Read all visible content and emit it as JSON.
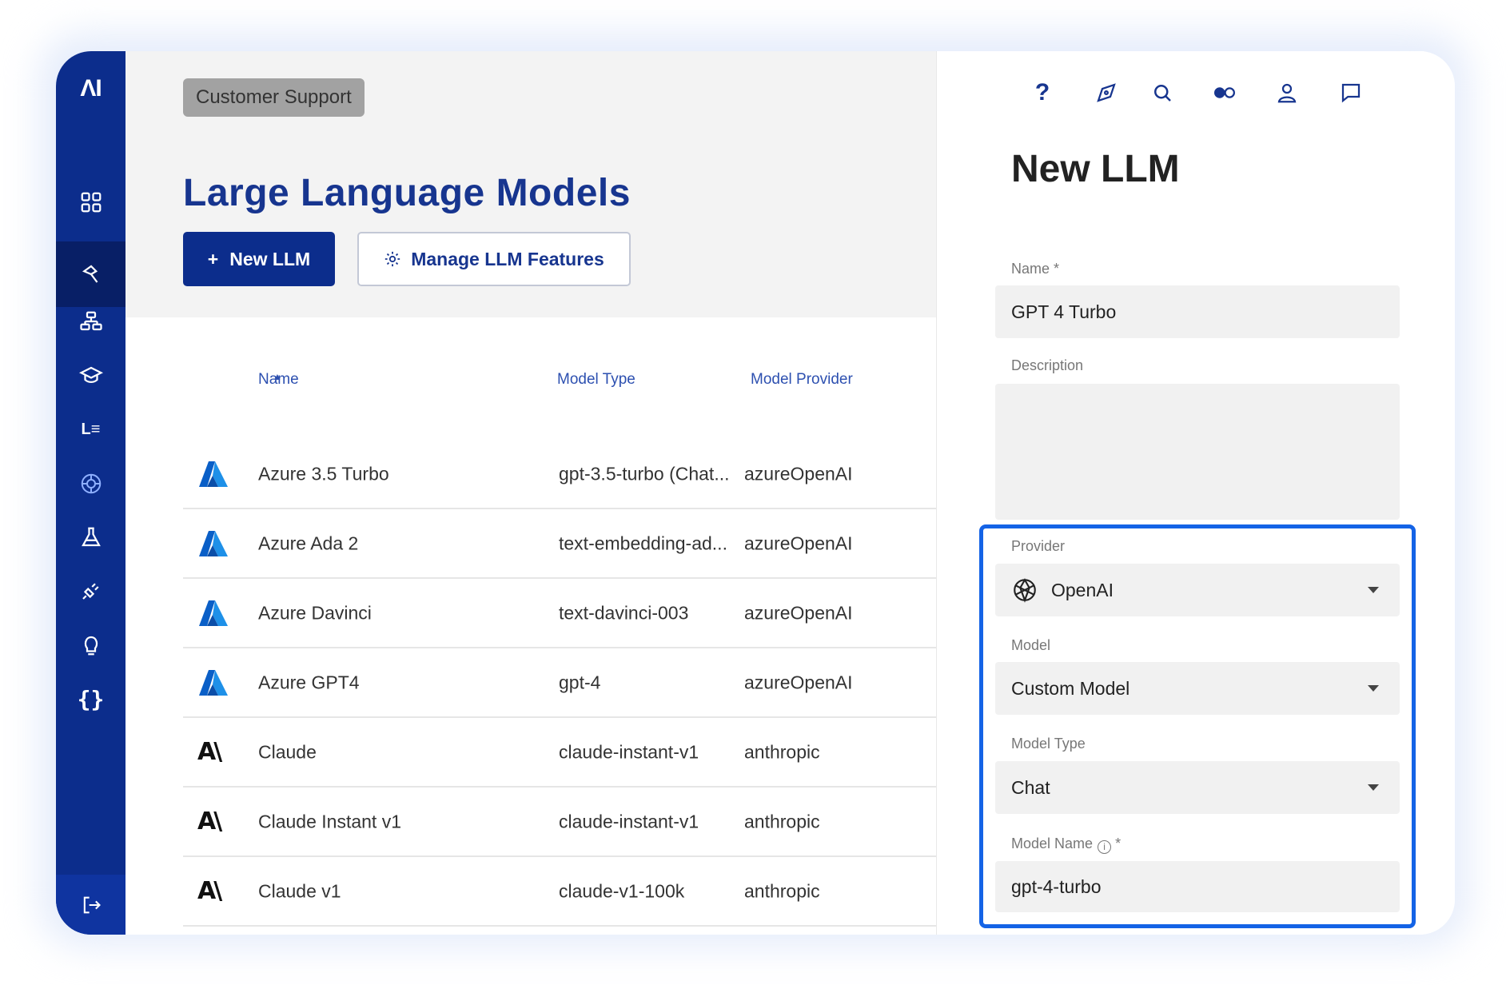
{
  "sidebar": {
    "logo": "ΛI",
    "items": [
      {
        "icon": "dashboard-grid-icon"
      },
      {
        "icon": "llm-brush-icon",
        "active": true
      },
      {
        "icon": "hierarchy-icon"
      },
      {
        "icon": "education-cap-icon"
      },
      {
        "icon": "list-icon",
        "text": "L≡"
      },
      {
        "icon": "openai-brain-icon"
      },
      {
        "icon": "lab-flask-icon"
      },
      {
        "icon": "plug-icon"
      },
      {
        "icon": "lightbulb-icon"
      },
      {
        "icon": "braces-icon",
        "text": "{}"
      }
    ],
    "logout_icon": "logout-icon"
  },
  "main": {
    "breadcrumb": "Customer Support",
    "title": "Large Language Models",
    "new_button": "New LLM",
    "new_button_icon": "+",
    "manage_button": "Manage LLM Features",
    "table": {
      "headers": {
        "name": "Name",
        "model_type": "Model Type",
        "model_provider": "Model Provider"
      },
      "sort_indicator": "▲",
      "rows": [
        {
          "logo": "azure",
          "name": "Azure 3.5 Turbo",
          "model_type": "gpt-3.5-turbo (Chat...",
          "provider": "azureOpenAI"
        },
        {
          "logo": "azure",
          "name": "Azure Ada 2",
          "model_type": "text-embedding-ad...",
          "provider": "azureOpenAI"
        },
        {
          "logo": "azure",
          "name": "Azure Davinci",
          "model_type": "text-davinci-003",
          "provider": "azureOpenAI"
        },
        {
          "logo": "azure",
          "name": "Azure GPT4",
          "model_type": "gpt-4",
          "provider": "azureOpenAI"
        },
        {
          "logo": "anthropic",
          "name": "Claude",
          "model_type": "claude-instant-v1",
          "provider": "anthropic"
        },
        {
          "logo": "anthropic",
          "name": "Claude Instant v1",
          "model_type": "claude-instant-v1",
          "provider": "anthropic"
        },
        {
          "logo": "anthropic",
          "name": "Claude v1",
          "model_type": "claude-v1-100k",
          "provider": "anthropic"
        }
      ]
    }
  },
  "panel": {
    "top_icons": [
      "help-icon",
      "compass-icon",
      "search-icon",
      "toggle-icon",
      "user-icon",
      "chat-icon"
    ],
    "help_glyph": "?",
    "title": "New LLM",
    "fields": {
      "name": {
        "label": "Name *",
        "value": "GPT 4 Turbo"
      },
      "description": {
        "label": "Description",
        "value": ""
      },
      "provider": {
        "label": "Provider",
        "value": "OpenAI"
      },
      "model": {
        "label": "Model",
        "value": "Custom Model"
      },
      "model_type": {
        "label": "Model Type",
        "value": "Chat"
      },
      "model_name": {
        "label": "Model Name",
        "required_mark": "*",
        "info_glyph": "i",
        "value": "gpt-4-turbo"
      }
    }
  },
  "colors": {
    "sidebar": "#0c2d8c",
    "accent": "#17358f",
    "highlight_border": "#1463e6"
  }
}
